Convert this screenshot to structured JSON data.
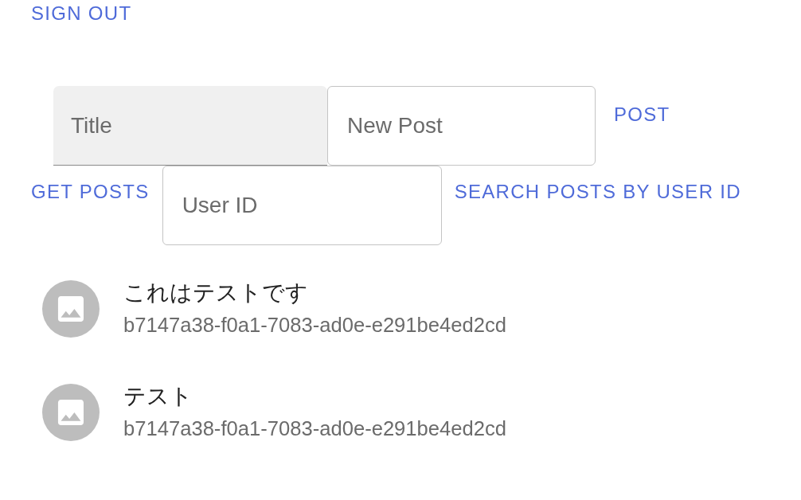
{
  "header": {
    "sign_out_button": "SIGN OUT"
  },
  "post_form": {
    "fields": [
      {
        "kind": "filled",
        "placeholder": "Title"
      },
      {
        "kind": "outlined",
        "placeholder": "New Post"
      }
    ],
    "post_button": "POST"
  },
  "search_form": {
    "get_posts_button": "GET POSTS",
    "user_id_field": {
      "placeholder": "User ID"
    },
    "search_button": "SEARCH POSTS BY USER ID"
  },
  "posts": [
    {
      "title": "これはテストです",
      "user_id": "b7147a38-f0a1-7083-ad0e-e291be4ed2cd"
    },
    {
      "title": "テスト",
      "user_id": "b7147a38-f0a1-7083-ad0e-e291be4ed2cd"
    }
  ]
}
